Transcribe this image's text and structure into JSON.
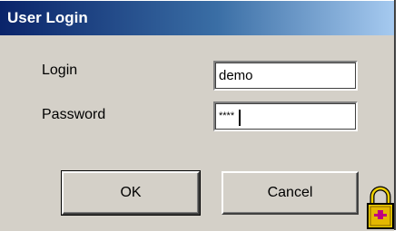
{
  "window": {
    "title": "User Login"
  },
  "form": {
    "login_label": "Login",
    "login_value": "demo",
    "password_label": "Password",
    "password_value": "****"
  },
  "buttons": {
    "ok_label": "OK",
    "cancel_label": "Cancel"
  },
  "icons": {
    "lock": "padlock-icon"
  },
  "colors": {
    "titlebar_start": "#0a246a",
    "dialog_bg": "#d4d0c8",
    "lock_gold": "#f0d000"
  }
}
